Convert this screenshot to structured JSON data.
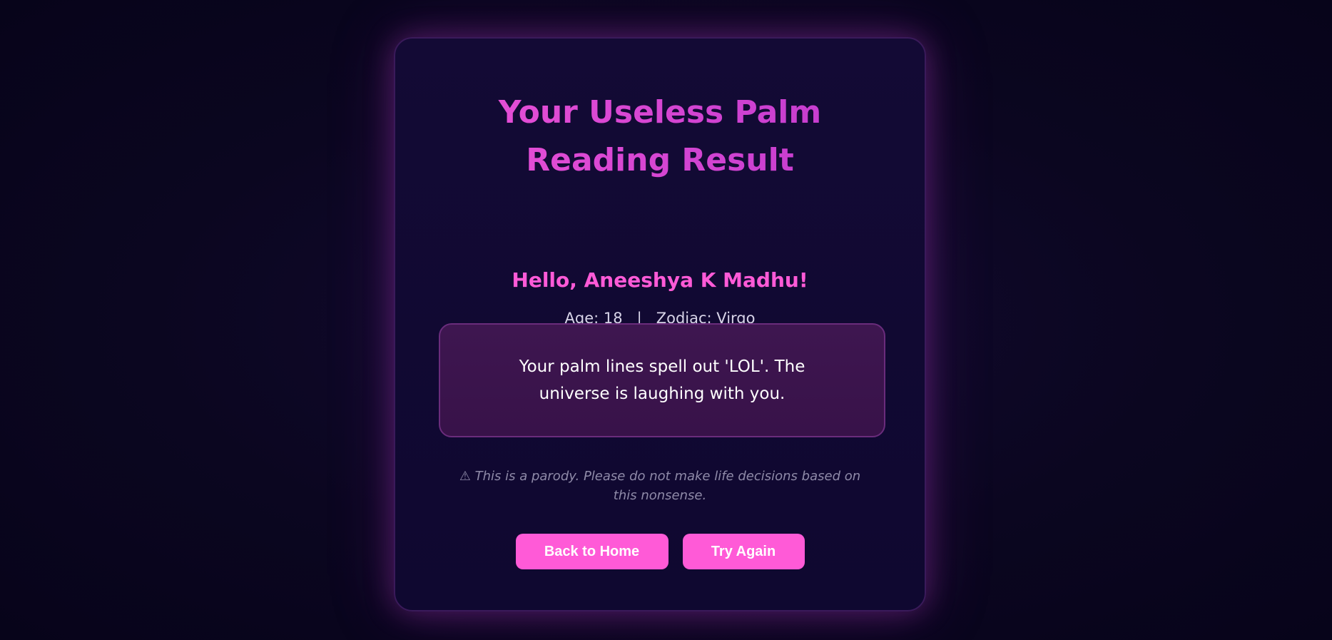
{
  "card": {
    "title": "Your Useless Palm Reading Result",
    "greeting": "Hello, Aneeshya K Madhu!",
    "meta": "Age: 18   |   Zodiac: Virgo",
    "reading": "Your palm lines spell out 'LOL'. The universe is laughing with you.",
    "disclaimer": "⚠ This is a parody. Please do not make life decisions based on this nonsense.",
    "buttons": {
      "home_label": "Back to Home",
      "again_label": "Try Again"
    }
  },
  "colors": {
    "background": "#0b0620",
    "card_border": "#3a1a5a",
    "accent_pink": "#ff5ad7",
    "title_magenta": "#d93ed6",
    "reading_box": "#3e1650"
  }
}
